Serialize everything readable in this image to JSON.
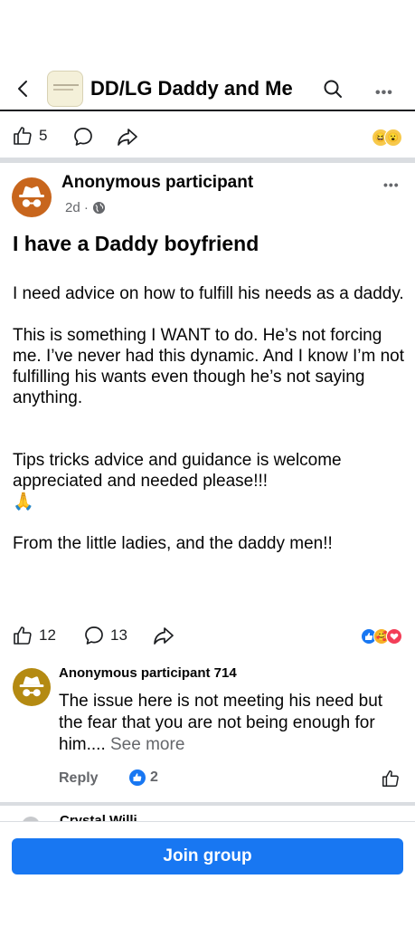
{
  "header": {
    "title": "DD/LG Daddy and Me",
    "back_icon": "chevron-left-icon",
    "search_icon": "search-icon",
    "more_label": "•••"
  },
  "previous_post": {
    "like_count": "5"
  },
  "post": {
    "author": "Anonymous participant",
    "time": "2d ·",
    "more_label": "•••",
    "title": "I have a Daddy boyfriend",
    "body": {
      "p1": "I need advice on how to fulfill his needs as a daddy.",
      "p2": "This is something I WANT to do. He’s not forcing me. I’ve never had this dynamic. And I know I’m not fulfilling his wants even though he’s not saying anything.",
      "p3": "Tips tricks advice and guidance is welcome appreciated and needed please!!!",
      "p3_emoji": "🙏",
      "p4": "From the little ladies, and the daddy men!!"
    },
    "like_count": "12",
    "comment_count": "13",
    "reaction_colors": {
      "like": "#1877f2",
      "care": "#f7b125",
      "love": "#f33e58"
    }
  },
  "comment": {
    "author": "Anonymous participant 714",
    "text": "The issue here is not meeting his need but the fear that you are not being enough for him....",
    "see_more": " See more",
    "reply_label": "Reply",
    "like_count": "2"
  },
  "next_comment_peek": {
    "author": "Crystal Willi"
  },
  "footer": {
    "join_label": "Join group"
  },
  "colors": {
    "accent": "#1877f2",
    "avatar_post": "#c8661d",
    "avatar_comment": "#b48a12",
    "divider": "#dadde1"
  }
}
